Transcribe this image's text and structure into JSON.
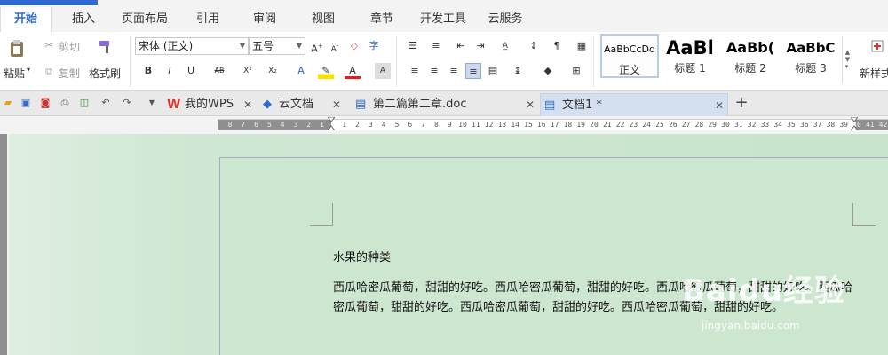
{
  "menu": {
    "tabs": [
      "开始",
      "插入",
      "页面布局",
      "引用",
      "审阅",
      "视图",
      "章节",
      "开发工具",
      "云服务"
    ],
    "active": "开始"
  },
  "ribbon": {
    "paste": "粘贴",
    "cut": "剪切",
    "copy": "复制",
    "format_painter": "格式刷",
    "font_name": "宋体 (正文)",
    "font_size": "五号",
    "styles": [
      {
        "sample": "AaBbCcDd",
        "name": "正文"
      },
      {
        "sample": "AaBl",
        "name": "标题 1"
      },
      {
        "sample": "AaBb(",
        "name": "标题 2"
      },
      {
        "sample": "AaBbC",
        "name": "标题 3"
      }
    ],
    "new_style_partial": "新样式"
  },
  "doc_tabs": [
    {
      "label": "我的WPS"
    },
    {
      "label": "云文档"
    },
    {
      "label": "第二篇第二章.doc"
    },
    {
      "label": "文档1 *"
    }
  ],
  "ruler": {
    "left_ticks": [
      "8",
      "7",
      "6",
      "5",
      "4",
      "3",
      "2",
      "1"
    ],
    "right_ticks": [
      "1",
      "2",
      "3",
      "4",
      "5",
      "6",
      "7",
      "8",
      "9",
      "10",
      "11",
      "12",
      "13",
      "14",
      "15",
      "16",
      "17",
      "18",
      "19",
      "20",
      "21",
      "22",
      "23",
      "24",
      "25",
      "26",
      "27",
      "28",
      "29",
      "30",
      "31",
      "32",
      "33",
      "34",
      "35",
      "36",
      "37",
      "38",
      "39",
      "40",
      "41",
      "42"
    ]
  },
  "document": {
    "heading": "水果的种类",
    "paragraph": "西瓜哈密瓜葡萄，甜甜的好吃。西瓜哈密瓜葡萄，甜甜的好吃。西瓜哈密瓜葡萄，甜甜的好吃。西瓜哈密瓜葡萄，甜甜的好吃。西瓜哈密瓜葡萄，甜甜的好吃。西瓜哈密瓜葡萄，甜甜的好吃。"
  },
  "watermark": {
    "brand": "Baidu经验",
    "url": "jingyan.baidu.com"
  },
  "colors": {
    "accent": "#2e6ad0",
    "page_bg": "#cde6cf",
    "wps_red": "#e0312c"
  }
}
